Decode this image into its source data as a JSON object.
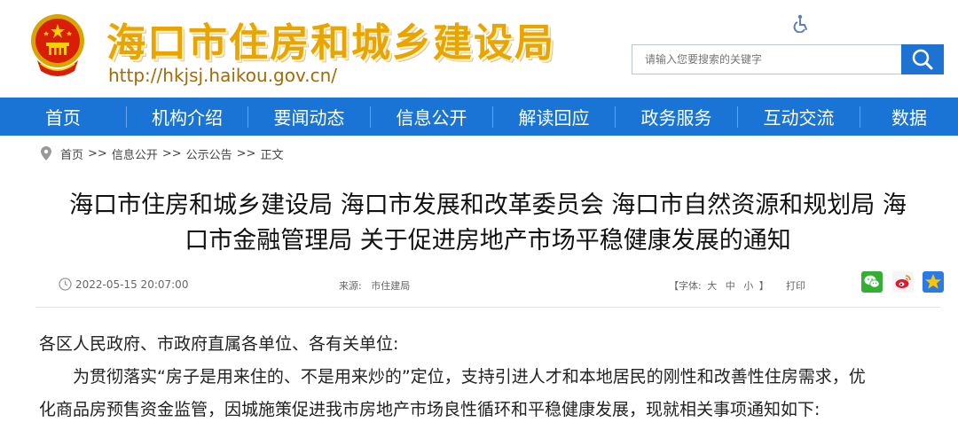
{
  "header": {
    "site_title": "海口市住房和城乡建设局",
    "site_url": "http://hkjsj.haikou.gov.cn/",
    "search_placeholder": "请输入您要搜索的关键字"
  },
  "nav": {
    "items": [
      "首页",
      "机构介绍",
      "要闻动态",
      "信息公开",
      "解读回应",
      "政务服务",
      "互动交流",
      "数据"
    ]
  },
  "breadcrumb": {
    "items": [
      "首页",
      "信息公开",
      "公示公告",
      "正文"
    ],
    "separator": ">>"
  },
  "article": {
    "title_line1": "海口市住房和城乡建设局 海口市发展和改革委员会 海口市自然资源和规划局 海",
    "title_line2": "口市金融管理局 关于促进房地产市场平稳健康发展的通知",
    "date": "2022-05-15 20:07:00",
    "source_label": "来源:",
    "source_value": "市住建局",
    "font_label_open": "【字体:",
    "font_large": "大",
    "font_medium": "中",
    "font_small": "小",
    "font_label_close": "】",
    "print_label": "打印",
    "body_line1": "各区人民政府、市政府直属各单位、各有关单位:",
    "body_line2": "为贯彻落实“房子是用来住的、不是用来炒的”定位，支持引进人才和本地居民的刚性和改善性住房需求，优",
    "body_line3": "化商品房预售资金监管，因城施策促进我市房地产市场良性循环和平稳健康发展，现就相关事项通知如下:"
  },
  "colors": {
    "nav_bg": "#1a74d6",
    "title_gold": "#e8a500",
    "emblem_red": "#d81e06"
  }
}
